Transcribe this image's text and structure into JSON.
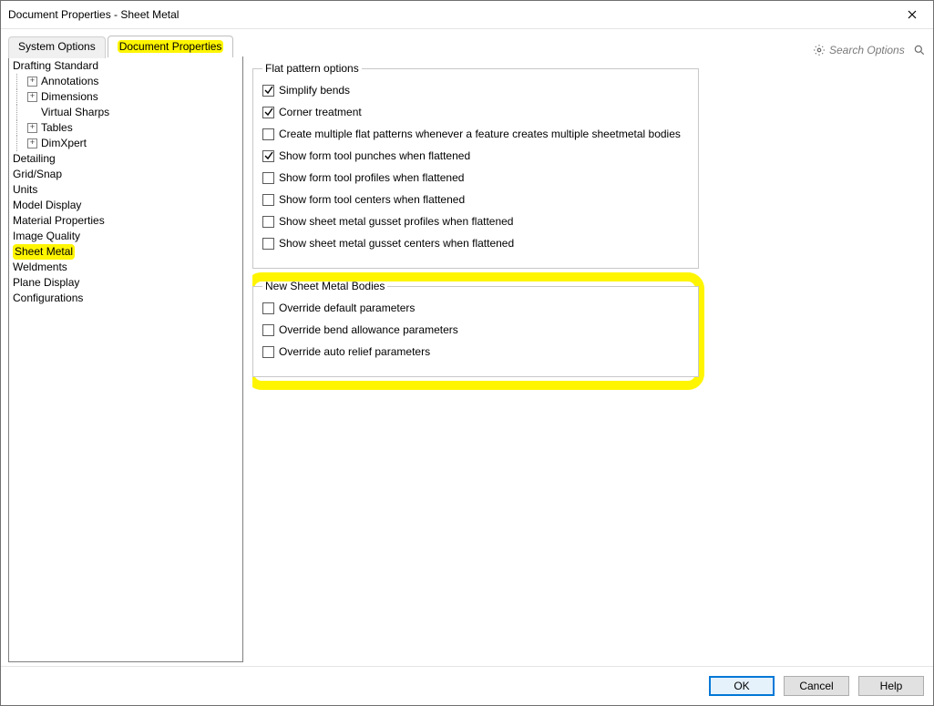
{
  "window": {
    "title": "Document Properties - Sheet Metal"
  },
  "tabs": {
    "system_options": "System Options",
    "document_properties": "Document Properties"
  },
  "search": {
    "placeholder": "Search Options"
  },
  "tree": {
    "drafting_standard": "Drafting Standard",
    "annotations": "Annotations",
    "dimensions": "Dimensions",
    "virtual_sharps": "Virtual Sharps",
    "tables": "Tables",
    "dimxpert": "DimXpert",
    "detailing": "Detailing",
    "grid_snap": "Grid/Snap",
    "units": "Units",
    "model_display": "Model Display",
    "material_properties": "Material Properties",
    "image_quality": "Image Quality",
    "sheet_metal": "Sheet Metal",
    "weldments": "Weldments",
    "plane_display": "Plane Display",
    "configurations": "Configurations"
  },
  "groups": {
    "flat_pattern": {
      "legend": "Flat pattern options",
      "simplify_bends": {
        "label": "Simplify bends",
        "checked": true
      },
      "corner_treatment": {
        "label": "Corner treatment",
        "checked": true
      },
      "create_multiple": {
        "label": "Create multiple flat patterns whenever a feature creates multiple sheetmetal bodies",
        "checked": false
      },
      "show_punches": {
        "label": "Show form tool punches when flattened",
        "checked": true
      },
      "show_profiles": {
        "label": "Show form tool profiles when flattened",
        "checked": false
      },
      "show_centers": {
        "label": "Show form tool centers when flattened",
        "checked": false
      },
      "show_gusset_profiles": {
        "label": "Show sheet metal gusset profiles when flattened",
        "checked": false
      },
      "show_gusset_centers": {
        "label": "Show sheet metal gusset centers when flattened",
        "checked": false
      }
    },
    "new_bodies": {
      "legend": "New Sheet Metal Bodies",
      "override_default": {
        "label": "Override default parameters",
        "checked": false
      },
      "override_bend": {
        "label": "Override bend allowance parameters",
        "checked": false
      },
      "override_relief": {
        "label": "Override auto relief parameters",
        "checked": false
      }
    }
  },
  "buttons": {
    "ok": "OK",
    "cancel": "Cancel",
    "help": "Help"
  }
}
